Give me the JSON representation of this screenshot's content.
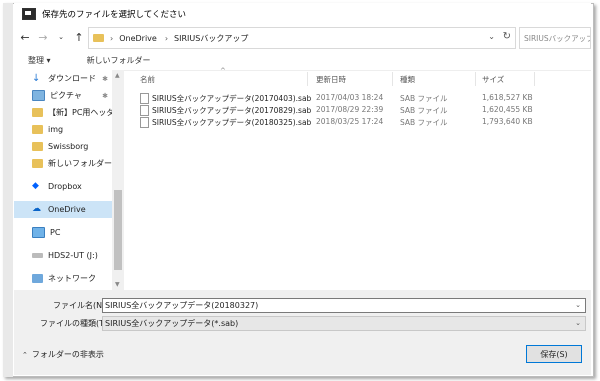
{
  "window": {
    "title": "保存先のファイルを選択してください"
  },
  "nav": {
    "back_icon": "arrow-left-icon",
    "forward_icon": "arrow-right-icon",
    "recent_icon": "chevron-down-icon",
    "up_icon": "arrow-up-icon",
    "breadcrumb": [
      "OneDrive",
      "SIRIUSバックアップ"
    ],
    "search_placeholder": "SIRIUSバックアップの..."
  },
  "toolbar": {
    "organize": "整理 ▾",
    "new_folder": "新しいフォルダー"
  },
  "sidebar": {
    "items": [
      {
        "label": "ダウンロード",
        "icon": "download-icon",
        "pinned": true
      },
      {
        "label": "ピクチャ",
        "icon": "pictures-icon",
        "pinned": true
      },
      {
        "label": "【新】PC用ヘッダー",
        "icon": "folder-icon",
        "pinned": false
      },
      {
        "label": "img",
        "icon": "folder-icon",
        "pinned": false
      },
      {
        "label": "Swissborg",
        "icon": "folder-icon",
        "pinned": false
      },
      {
        "label": "新しいフォルダー",
        "icon": "folder-icon",
        "pinned": false
      },
      {
        "label": "Dropbox",
        "icon": "dropbox-icon",
        "pinned": false
      },
      {
        "label": "OneDrive",
        "icon": "cloud-icon",
        "pinned": false,
        "selected": true
      },
      {
        "label": "PC",
        "icon": "computer-icon",
        "pinned": false
      },
      {
        "label": "HDS2-UT (J:)",
        "icon": "drive-icon",
        "pinned": false
      },
      {
        "label": "ネットワーク",
        "icon": "network-icon",
        "pinned": false
      }
    ]
  },
  "files": {
    "columns": {
      "name": "名前",
      "date": "更新日時",
      "type": "種類",
      "size": "サイズ"
    },
    "rows": [
      {
        "name": "SIRIUS全バックアップデータ(20170403).sab",
        "date": "2017/04/03 18:24",
        "type": "SAB ファイル",
        "size": "1,618,527 KB"
      },
      {
        "name": "SIRIUS全バックアップデータ(20170829).sab",
        "date": "2017/08/29 22:39",
        "type": "SAB ファイル",
        "size": "1,620,455 KB"
      },
      {
        "name": "SIRIUS全バックアップデータ(20180325).sab",
        "date": "2018/03/25 17:24",
        "type": "SAB ファイル",
        "size": "1,793,640 KB"
      }
    ]
  },
  "bottom": {
    "filename_label": "ファイル名(N):",
    "filename_value": "SIRIUS全バックアップデータ(20180327)",
    "filetype_label": "ファイルの種類(T):",
    "filetype_value": "SIRIUS全バックアップデータ(*.sab)",
    "hide_folders": "フォルダーの非表示",
    "save_button": "保存(S)"
  }
}
